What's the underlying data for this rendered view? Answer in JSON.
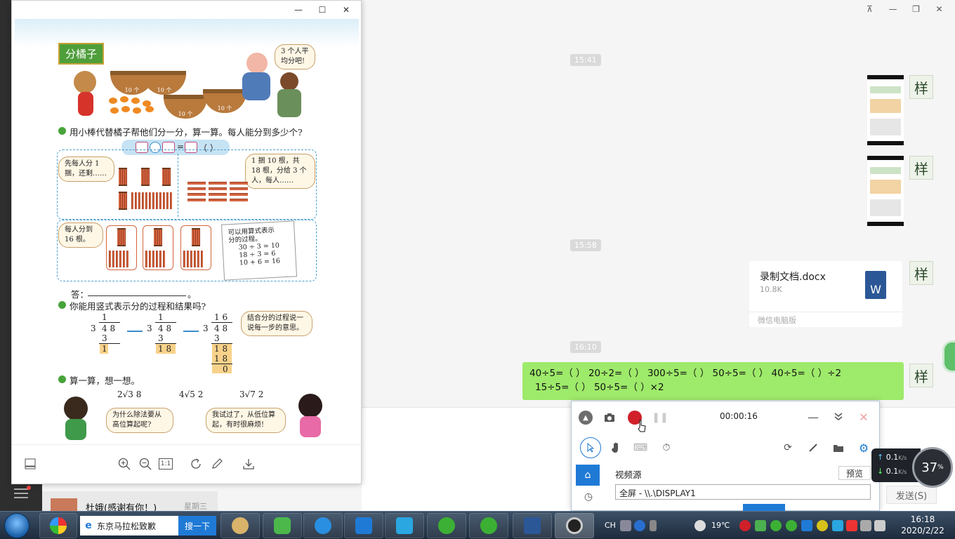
{
  "chat": {
    "window_controls": [
      "⊼",
      "—",
      "❐",
      "✕"
    ],
    "times": [
      "15:41",
      "15:58",
      "16:10"
    ],
    "avatar_glyph": "样",
    "file": {
      "name": "录制文档.docx",
      "size": "10.8K",
      "source": "微信电脑版",
      "icon_letter": "W"
    },
    "message": {
      "line1": "40÷5=（ ）  20÷2=（ ）  300÷5=（ ）  50÷5=（ ）  40÷5=（   ）÷2",
      "line2": "15÷5=（ ）  50÷5=（ ）×2"
    },
    "send_label": "发送(S)",
    "contact": {
      "name": "杜娥(感谢有你！)",
      "day": "星期三"
    }
  },
  "viewer": {
    "window_controls": [
      "—",
      "☐",
      "✕"
    ],
    "page": {
      "title": "分橘子",
      "speech_pig": "3 个人平均分吧!",
      "basket_label": "10 个",
      "q1": "用小棒代替橘子帮他们分一分，算一算。每人能分到多少个?",
      "formula_eq": "=",
      "formula_paren": "（  ）",
      "speech_a": "先每人分 1 捆，还剩……",
      "speech_b": "1 捆 10 根，共 18 根，分给 3 个人，每人……",
      "speech_c": "每人分到 16 根。",
      "note_lines": [
        "可以用算式表示",
        "分的过程。",
        "30 ÷ 3 = 10",
        "18 ÷ 3 = 6",
        "10 + 6 = 16"
      ],
      "answer_label": "答：",
      "answer_end": "。",
      "q2": "你能用竖式表示分的过程和结果吗?",
      "speech_d": "结合分的过程说一说每一步的意思。",
      "q3": "算一算，想一想。",
      "problems": [
        "2√3 8",
        "4√5 2",
        "3√7 2"
      ],
      "speech_boy": "为什么除法要从高位算起呢?",
      "speech_girl": "我试过了，从低位算起，有时很麻烦!",
      "div1": {
        "divisor": "3",
        "quotient": "1",
        "dividend": "4 8",
        "sub": "3",
        "rem": "1"
      },
      "div2": {
        "divisor": "3",
        "quotient": "1",
        "dividend": "4 8",
        "sub": "3",
        "rem": "1 8"
      },
      "div3": {
        "divisor": "3",
        "quotient": "1 6",
        "dividend": "4 8",
        "sub": "3",
        "rem": "1 8",
        "sub2": "1 8",
        "zero": "0"
      }
    },
    "toolbar_icons": [
      "thumbnail-icon",
      "zoom-in-icon",
      "zoom-out-icon",
      "actual-size-icon",
      "rotate-icon",
      "edit-icon",
      "download-icon"
    ],
    "actual_size_label": "1:1"
  },
  "recorder": {
    "time": "00:00:16",
    "source_label": "视频源",
    "preview_label": "预览",
    "source_value": "全屏 - \\\\.\\DISPLAY1"
  },
  "speed": {
    "up": "0.1",
    "down": "0.1",
    "unit": "K/s",
    "percent": "37",
    "percent_sign": "%"
  },
  "taskbar": {
    "search_value": "东京马拉松致歉",
    "search_button": "搜一下",
    "ime": "CH",
    "temperature": "19℃",
    "time": "16:18",
    "date": "2020/2/22"
  },
  "colors": {
    "bubble_green": "#9eea6a",
    "record_red": "#d0202a",
    "accent_blue": "#1f7ad6",
    "title_green": "#4e9e3a"
  }
}
